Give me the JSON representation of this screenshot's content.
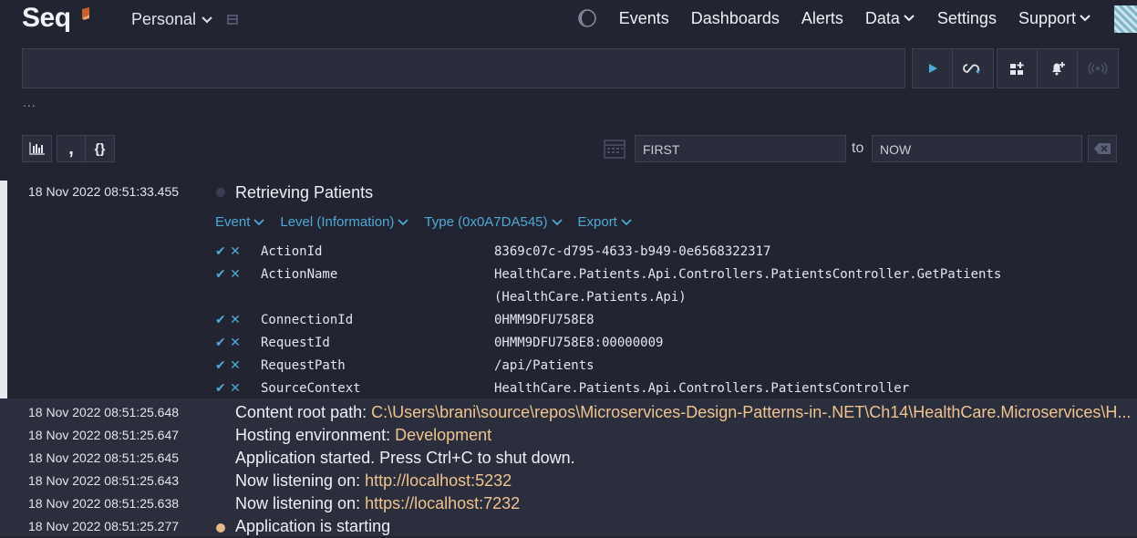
{
  "app": {
    "logo": "Seq",
    "workspace": "Personal"
  },
  "nav": {
    "events": "Events",
    "dashboards": "Dashboards",
    "alerts": "Alerts",
    "data": "Data",
    "settings": "Settings",
    "support": "Support"
  },
  "search": {
    "placeholder": "",
    "value": "",
    "more": "..."
  },
  "range": {
    "from": "FIRST",
    "to_label": "to",
    "to": "NOW"
  },
  "toolbar": {
    "comma": ",",
    "braces": "{}"
  },
  "colors": {
    "accent": "#4fa9d6",
    "level_info": "#e8b88a",
    "value": "#f0c48e"
  },
  "expanded": {
    "timestamp": "18 Nov 2022  08:51:33.455",
    "message": "Retrieving Patients",
    "menu": [
      "Event",
      "Level (Information)",
      "Type (0x0A7DA545)",
      "Export"
    ],
    "properties": [
      {
        "key": "ActionId",
        "value": "8369c07c-d795-4633-b949-0e6568322317"
      },
      {
        "key": "ActionName",
        "value": "HealthCare.Patients.Api.Controllers.PatientsController.GetPatients",
        "value2": "(HealthCare.Patients.Api)"
      },
      {
        "key": "ConnectionId",
        "value": "0HMM9DFU758E8"
      },
      {
        "key": "RequestId",
        "value": "0HMM9DFU758E8:00000009"
      },
      {
        "key": "RequestPath",
        "value": "/api/Patients"
      },
      {
        "key": "SourceContext",
        "value": "HealthCare.Patients.Api.Controllers.PatientsController"
      }
    ]
  },
  "events": [
    {
      "timestamp": "18 Nov 2022  08:51:25.648",
      "prefix": "Content root path: ",
      "value": "C:\\Users\\brani\\source\\repos\\Microservices-Design-Patterns-in-.NET\\Ch14\\HealthCare.Microservices\\H...",
      "suffix": ""
    },
    {
      "timestamp": "18 Nov 2022  08:51:25.647",
      "prefix": "Hosting environment: ",
      "value": "Development",
      "suffix": ""
    },
    {
      "timestamp": "18 Nov 2022  08:51:25.645",
      "prefix": "Application started. Press Ctrl+C to shut down.",
      "value": "",
      "suffix": ""
    },
    {
      "timestamp": "18 Nov 2022  08:51:25.643",
      "prefix": "Now listening on: ",
      "value": "http://localhost:5232",
      "suffix": ""
    },
    {
      "timestamp": "18 Nov 2022  08:51:25.638",
      "prefix": "Now listening on: ",
      "value": "https://localhost:7232",
      "suffix": ""
    },
    {
      "timestamp": "18 Nov 2022  08:51:25.277",
      "prefix": "Application is starting",
      "value": "",
      "suffix": ""
    }
  ]
}
